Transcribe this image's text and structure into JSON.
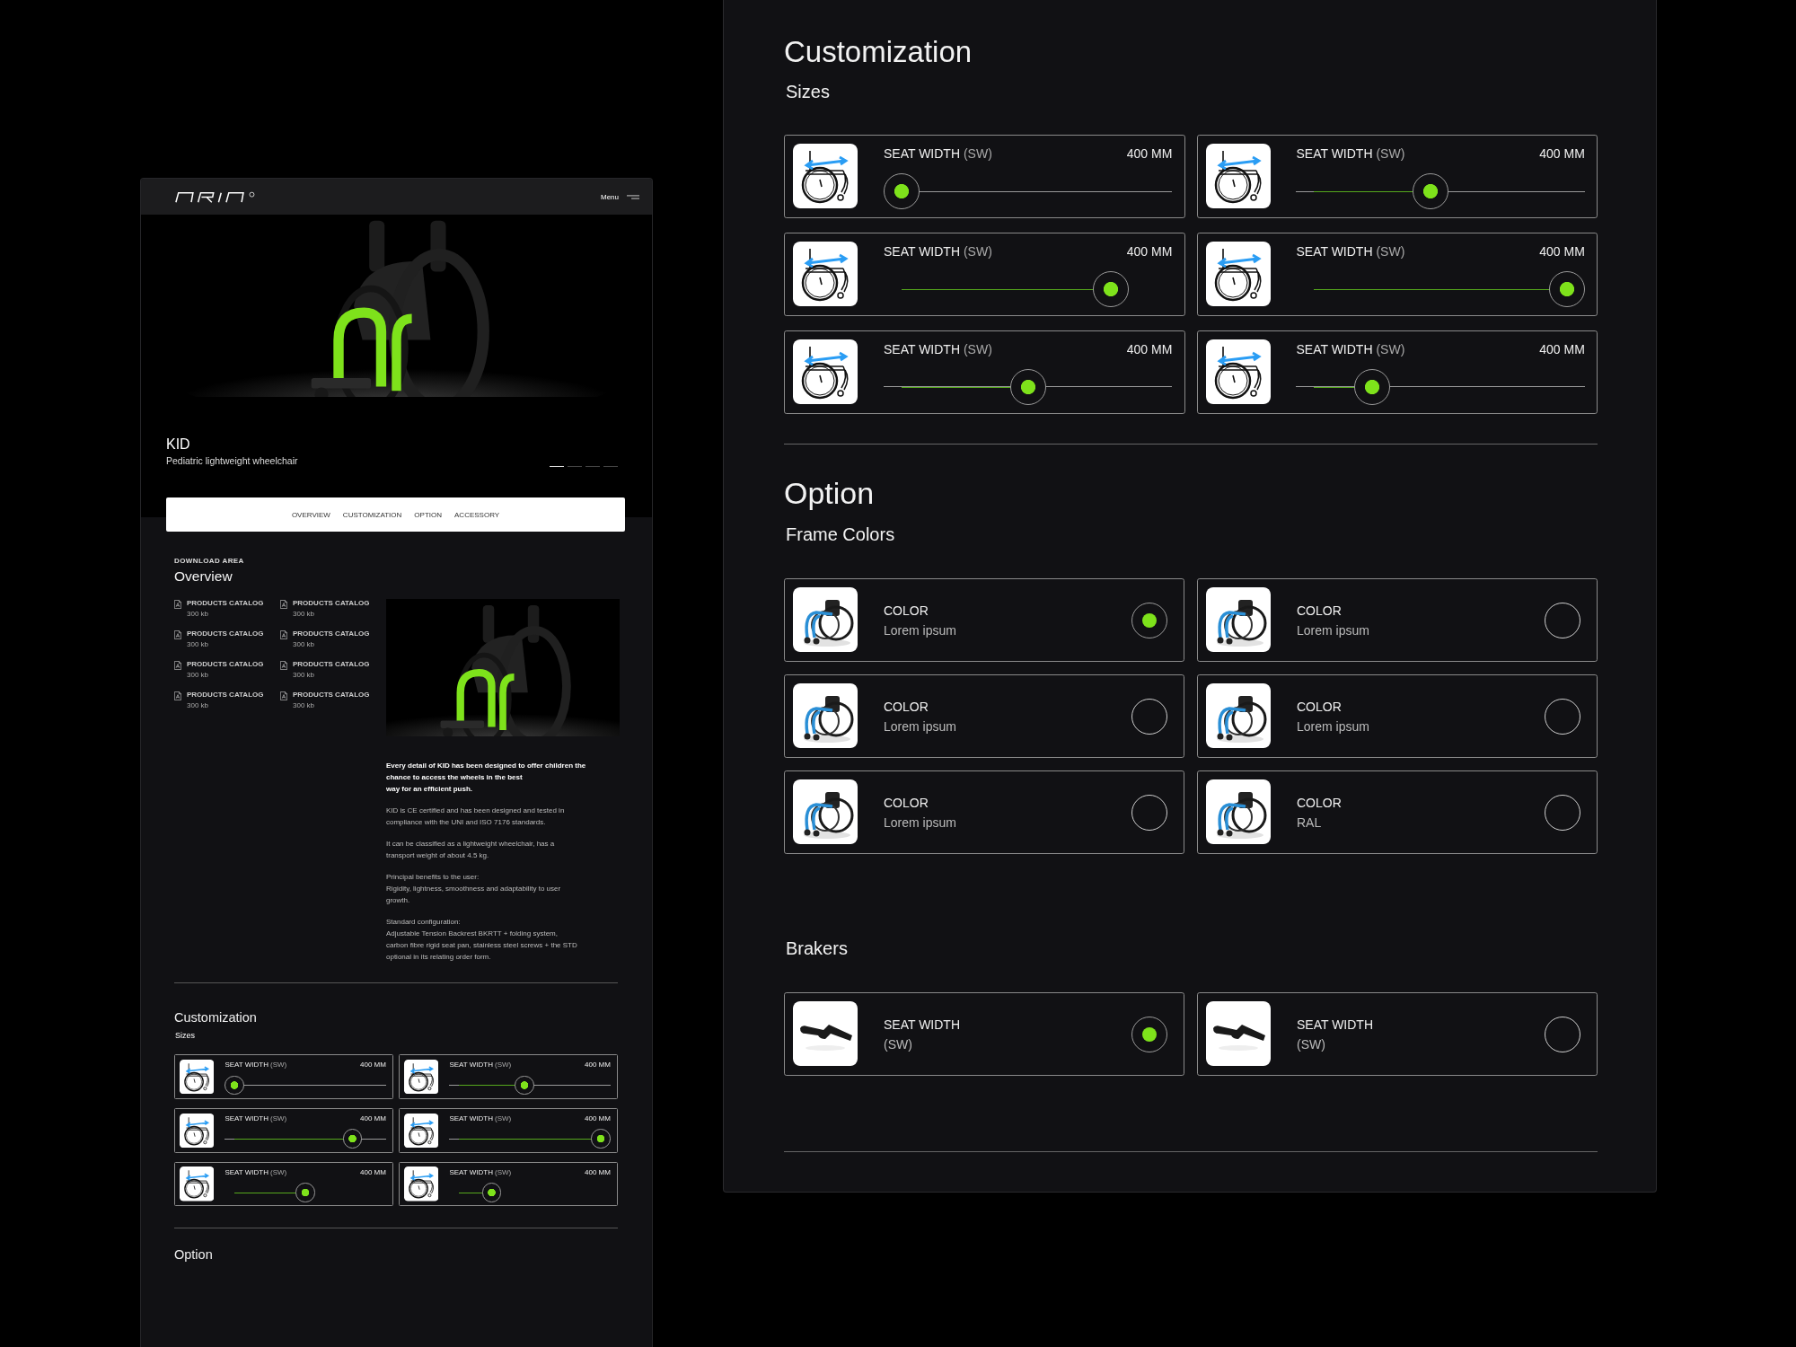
{
  "left_page": {
    "header": {
      "menu_label": "Menu"
    },
    "hero": {
      "kind": "picture",
      "title": "KID",
      "subtitle": "Pediatric lightweight wheelchair",
      "slides": [
        {
          "selected": true
        },
        {
          "selected": false
        },
        {
          "selected": false
        },
        {
          "selected": false
        }
      ]
    },
    "tabs": [
      "OVERVIEW",
      "CUSTOMIZATION",
      "OPTION",
      "ACCESSORY"
    ],
    "overview": {
      "eyebrow": "DOWNLOAD AREA",
      "title": "Overview",
      "downloads": [
        {
          "title": "PRODUCTS CATALOG",
          "size": "300 kb"
        },
        {
          "title": "PRODUCTS CATALOG",
          "size": "300 kb"
        },
        {
          "title": "PRODUCTS CATALOG",
          "size": "300 kb"
        },
        {
          "title": "PRODUCTS CATALOG",
          "size": "300 kb"
        },
        {
          "title": "PRODUCTS CATALOG",
          "size": "300 kb"
        },
        {
          "title": "PRODUCTS CATALOG",
          "size": "300 kb"
        },
        {
          "title": "PRODUCTS CATALOG",
          "size": "300 kb"
        },
        {
          "title": "PRODUCTS CATALOG",
          "size": "300 kb"
        }
      ],
      "lead": "Every detail of KID has been designed to offer children the\nchance to access the wheels in the best\nway for an efficient push.",
      "paragraphs": [
        "KID is CE certified and has been designed and tested in\ncompliance with the UNI and ISO 7176 standards.",
        "It can be classified as a lightweight wheelchair, has a\ntransport weight of about 4.5 kg.",
        "Principal benefits to the user:\nRigidity, lightness, smoothness and adaptability to user\ngrowth.",
        "Standard configuration:\nAdjustable Tension Backrest BKRTT + folding system,\ncarbon fibre rigid seat pan, stainless steel screws + the STD\noptional in its relating order form."
      ]
    },
    "customization": {
      "title": "Customization",
      "subtitle": "Sizes",
      "sliders": [
        {
          "label": "SEAT WIDTH",
          "unit": "(SW)",
          "reading": "400 MM",
          "level": 0
        },
        {
          "label": "SEAT WIDTH",
          "unit": "(SW)",
          "reading": "400 MM",
          "level": 0.46
        },
        {
          "label": "SEAT WIDTH",
          "unit": "(SW)",
          "reading": "400 MM",
          "level": 0.83
        },
        {
          "label": "SEAT WIDTH",
          "unit": "(SW)",
          "reading": "400 MM",
          "level": 1
        },
        {
          "label": "SEAT WIDTH",
          "unit": "(SW)",
          "reading": "400 MM",
          "level": 0.5
        },
        {
          "label": "SEAT WIDTH",
          "unit": "(SW)",
          "reading": "400 MM",
          "level": 0.23
        }
      ]
    },
    "option": {
      "title": "Option"
    }
  },
  "right_panel": {
    "customization": {
      "title": "Customization",
      "subtitle": "Sizes",
      "sliders": [
        {
          "label": "SEAT WIDTH",
          "unit": "(SW)",
          "reading": "400 MM",
          "level": 0
        },
        {
          "label": "SEAT WIDTH",
          "unit": "(SW)",
          "reading": "400 MM",
          "level": 0.46
        },
        {
          "label": "SEAT WIDTH",
          "unit": "(SW)",
          "reading": "400 MM",
          "level": 0.83
        },
        {
          "label": "SEAT WIDTH",
          "unit": "(SW)",
          "reading": "400 MM",
          "level": 1
        },
        {
          "label": "SEAT WIDTH",
          "unit": "(SW)",
          "reading": "400 MM",
          "level": 0.5
        },
        {
          "label": "SEAT WIDTH",
          "unit": "(SW)",
          "reading": "400 MM",
          "level": 0.23
        }
      ]
    },
    "option": {
      "title": "Option",
      "frame_colors": {
        "title": "Frame Colors",
        "items": [
          {
            "label": "COLOR",
            "value": "Lorem ipsum",
            "selected": true
          },
          {
            "label": "COLOR",
            "value": "Lorem ipsum",
            "selected": false
          },
          {
            "label": "COLOR",
            "value": "Lorem ipsum",
            "selected": false
          },
          {
            "label": "COLOR",
            "value": "Lorem ipsum",
            "selected": false
          },
          {
            "label": "COLOR",
            "value": "Lorem ipsum",
            "selected": false
          },
          {
            "label": "COLOR",
            "value": "RAL",
            "selected": false
          }
        ]
      },
      "brakers": {
        "title": "Brakers",
        "items": [
          {
            "label": "SEAT WIDTH",
            "value": "(SW)",
            "selected": true
          },
          {
            "label": "SEAT WIDTH",
            "value": "(SW)",
            "selected": false
          }
        ]
      }
    }
  }
}
